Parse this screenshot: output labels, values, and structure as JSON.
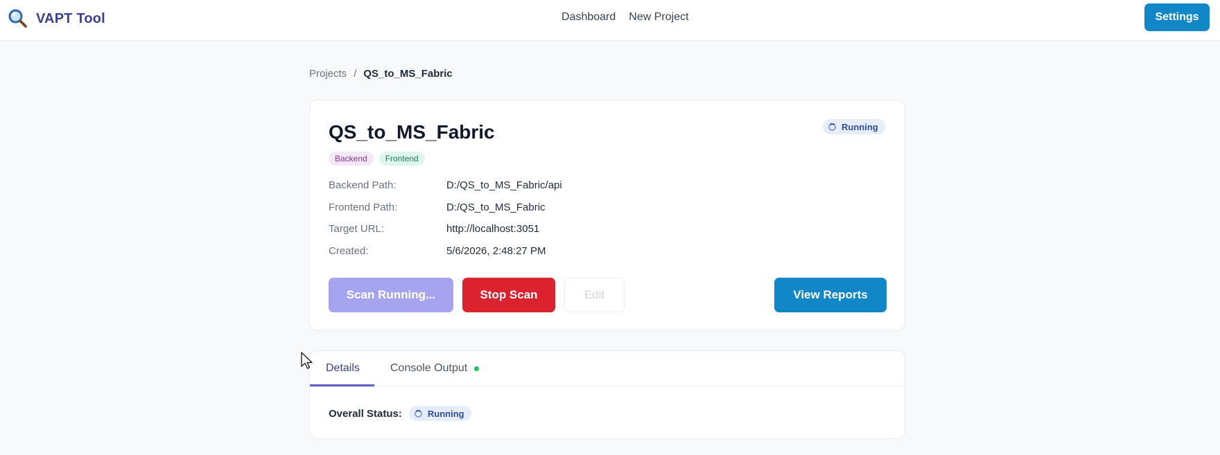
{
  "header": {
    "brand": "VAPT Tool",
    "nav": [
      "Dashboard",
      "New Project"
    ],
    "settings_label": "Settings"
  },
  "breadcrumb": {
    "parent": "Projects",
    "separator": "/",
    "current": "QS_to_MS_Fabric"
  },
  "project": {
    "title": "QS_to_MS_Fabric",
    "status": "Running",
    "tags": [
      "Backend",
      "Frontend"
    ],
    "details": [
      {
        "label": "Backend Path:",
        "value": "D:/QS_to_MS_Fabric/api"
      },
      {
        "label": "Frontend Path:",
        "value": "D:/QS_to_MS_Fabric"
      },
      {
        "label": "Target URL:",
        "value": "http://localhost:3051"
      },
      {
        "label": "Created:",
        "value": "5/6/2026, 2:48:27 PM"
      }
    ],
    "actions": {
      "scan_running": "Scan Running...",
      "stop_scan": "Stop Scan",
      "edit": "Edit",
      "view_reports": "View Reports"
    }
  },
  "tabs": {
    "items": [
      "Details",
      "Console Output"
    ],
    "active": "Details",
    "overall_status_label": "Overall Status:",
    "overall_status": "Running"
  },
  "colors": {
    "brand": "#3b3f94",
    "primary": "#1187c7",
    "danger": "#db2330",
    "disabled_primary": "#a6a4ee",
    "live": "#22c55e"
  },
  "icons": {
    "brand": "magnifier-icon",
    "status": "spinner-icon",
    "cursor": "mouse-pointer-icon"
  }
}
